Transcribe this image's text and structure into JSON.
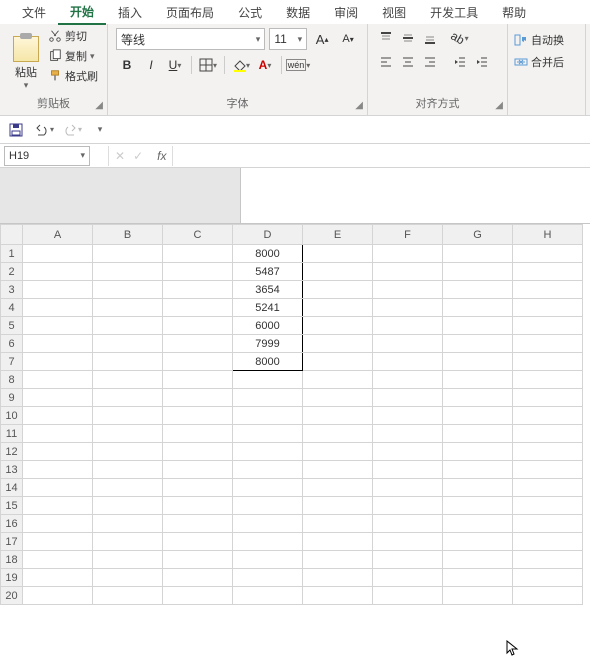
{
  "menu": {
    "items": [
      "文件",
      "开始",
      "插入",
      "页面布局",
      "公式",
      "数据",
      "审阅",
      "视图",
      "开发工具",
      "帮助"
    ],
    "active": 1
  },
  "clipboard": {
    "paste": "粘贴",
    "cut": "剪切",
    "copy": "复制",
    "format_painter": "格式刷",
    "group_label": "剪贴板"
  },
  "font": {
    "name": "等线",
    "size": "11",
    "group_label": "字体"
  },
  "align": {
    "group_label": "对齐方式"
  },
  "merge": {
    "autowrap": "自动换",
    "merge": "合并后"
  },
  "namebox": {
    "ref": "H19"
  },
  "columns": [
    "A",
    "B",
    "C",
    "D",
    "E",
    "F",
    "G",
    "H"
  ],
  "rows": 20,
  "data": {
    "D1": "8000",
    "D2": "5487",
    "D3": "3654",
    "D4": "5241",
    "D5": "6000",
    "D6": "7999",
    "D7": "8000"
  }
}
